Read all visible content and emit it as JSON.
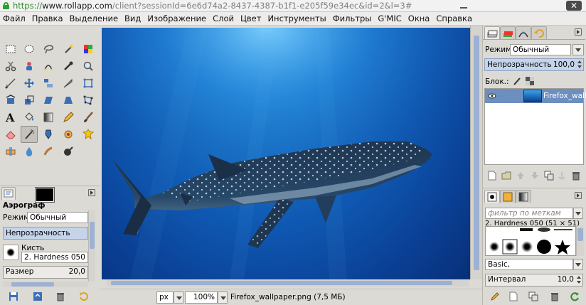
{
  "browser": {
    "url_scheme": "https://",
    "url_host": "www.rollapp.com",
    "url_rest": "/client?sessionId=6e6d74a2-8437-4387-b1f1-e205f59e34ec&id=2&l=3#",
    "close_glyph": "✕"
  },
  "menu": {
    "items": [
      "Файл",
      "Правка",
      "Выделение",
      "Вид",
      "Изображение",
      "Слой",
      "Цвет",
      "Инструменты",
      "Фильтры",
      "G'MIC",
      "Окна",
      "Справка"
    ]
  },
  "tool_options": {
    "title": "Аэрограф",
    "mode_label": "Режим:",
    "mode_value": "Обычный",
    "opacity_label": "Непрозрачность",
    "brush_label": "Кисть",
    "brush_value": "2. Hardness 050",
    "size_label": "Размер",
    "size_value": "20,0"
  },
  "status": {
    "unit": "px",
    "zoom": "100%",
    "file_info": "Firefox_wallpaper.png (7,5 МБ)"
  },
  "layers": {
    "mode_label": "Режим:",
    "mode_value": "Обычный",
    "opacity_label": "Непрозрачность",
    "opacity_value": "100,0",
    "lock_label": "Блок.:",
    "layer_name": "Firefox_wallpa"
  },
  "brushes": {
    "filter_placeholder": "фильтр по меткам",
    "selected_brush": "2. Hardness 050 (51 × 51)",
    "preset_value": "Basic,",
    "spacing_label": "Интервал",
    "spacing_value": "10,0"
  },
  "colors": {
    "accent": "#9db1d3",
    "selection": "#6d8fc0",
    "panel_bg": "#dcdad5"
  }
}
